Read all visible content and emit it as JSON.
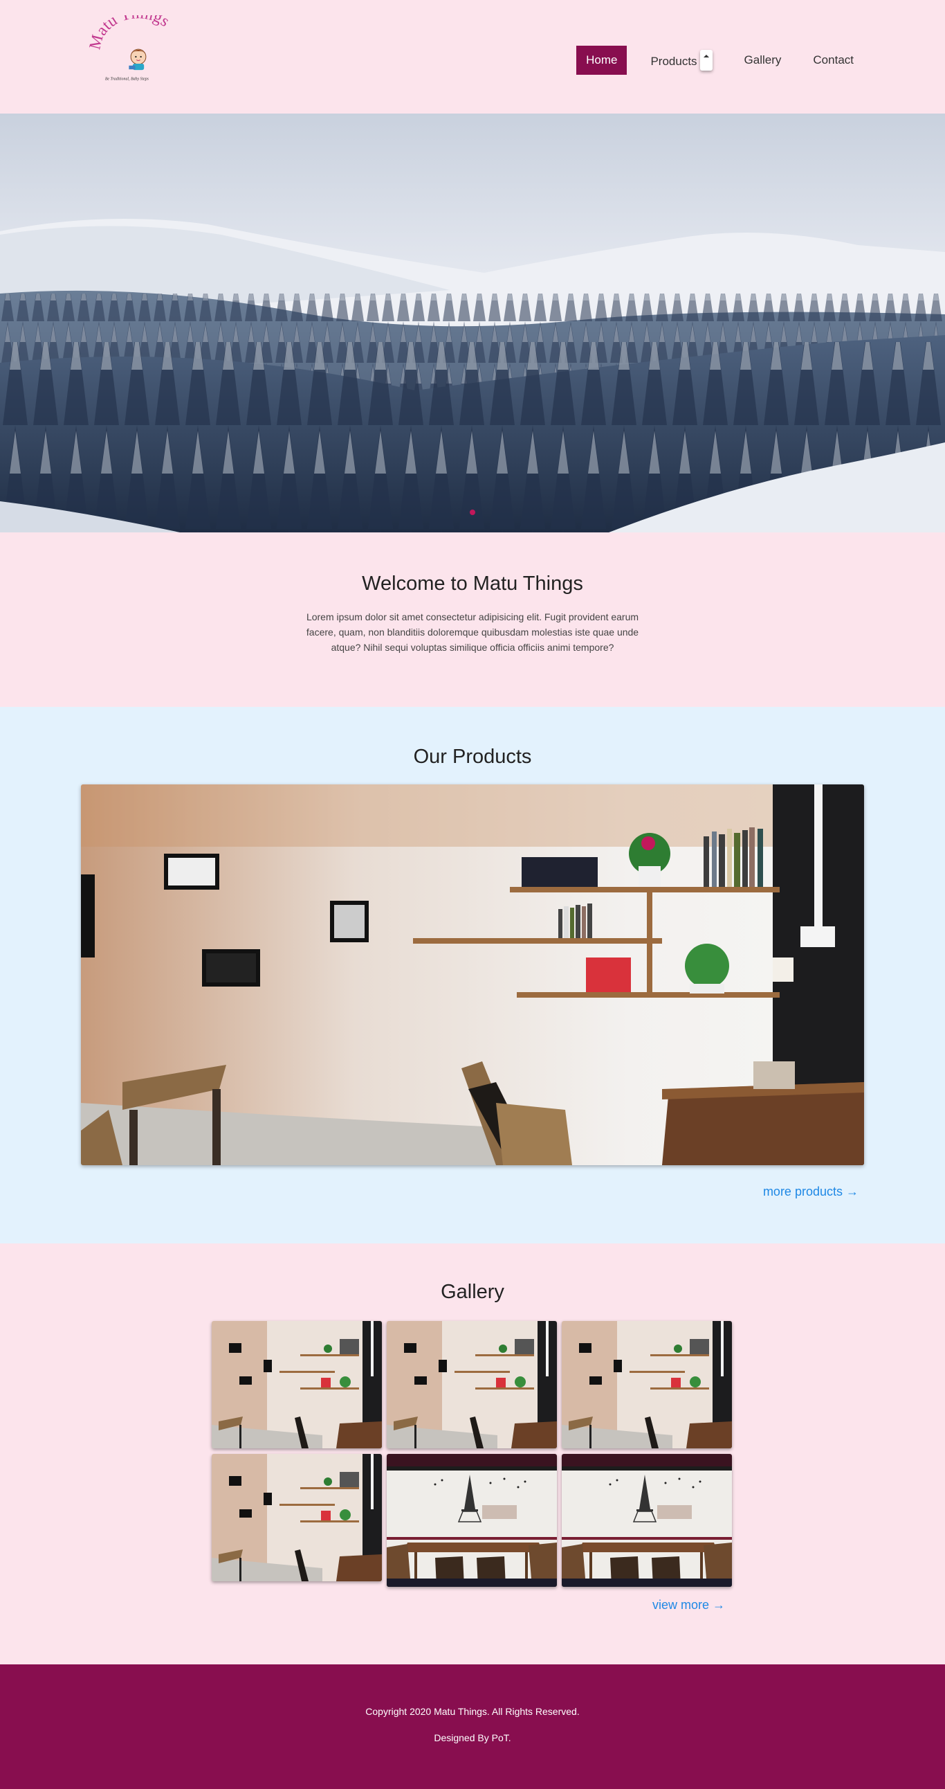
{
  "brand": {
    "logo_text": "Matu Things",
    "logo_tagline": "Be Traditional, Baby Steps"
  },
  "nav": {
    "items": [
      {
        "label": "Home",
        "active": true
      },
      {
        "label": "Products",
        "active": false,
        "has_dropdown": true
      },
      {
        "label": "Gallery",
        "active": false
      },
      {
        "label": "Contact",
        "active": false
      }
    ]
  },
  "hero": {
    "image": "snowy-forest-mountains"
  },
  "welcome": {
    "title": "Welcome to Matu Things",
    "text": "Lorem ipsum dolor sit amet consectetur adipisicing elit. Fugit provident earum facere, quam, non blanditiis doloremque quibusdam molestias iste quae unde atque? Nihil sequi voluptas similique officia officiis animi tempore?"
  },
  "products": {
    "title": "Our Products",
    "image": "cafe-wall-shelves",
    "more_label": "more products →"
  },
  "gallery": {
    "title": "Gallery",
    "images": [
      "cafe-wall-shelves",
      "cafe-wall-shelves",
      "cafe-wall-shelves",
      "cafe-wall-shelves",
      "cafe-eiffel-wall",
      "cafe-eiffel-wall"
    ],
    "more_label": "view more →"
  },
  "footer": {
    "copyright": "Copyright 2020 Matu Things. All Rights Reserved.",
    "credit": "Designed By PoT."
  },
  "colors": {
    "page_bg": "#fce4ec",
    "products_bg": "#e3f2fd",
    "accent": "#880e4f",
    "link": "#1e88e5"
  }
}
